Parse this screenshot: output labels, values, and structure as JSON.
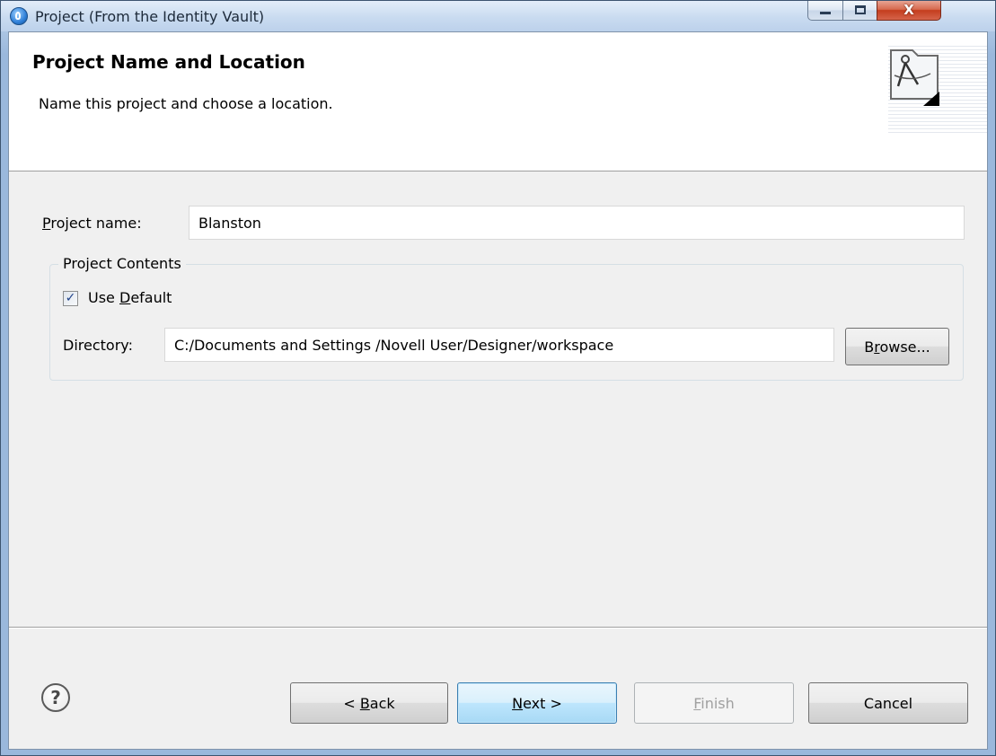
{
  "window": {
    "title": "Project (From the Identity Vault)",
    "close_glyph": "X"
  },
  "banner": {
    "title": "Project Name and Location",
    "description": "Name this project and choose a location."
  },
  "form": {
    "project_name_label": {
      "mnemonic": "P",
      "rest": "roject name:"
    },
    "project_name_value": "Blanston",
    "group_label": "Project Contents",
    "use_default": {
      "checked": true,
      "check_glyph": "✓",
      "label_pre": "Use ",
      "mnemonic": "D",
      "label_post": "efault"
    },
    "directory_label": "Directory:",
    "directory_value": "C:/Documents and Settings /Novell User/Designer/workspace",
    "browse": {
      "pre": "B",
      "mnemonic": "r",
      "post": "owse..."
    }
  },
  "footer": {
    "help_glyph": "?",
    "back": {
      "pre": "< ",
      "mnemonic": "B",
      "post": "ack"
    },
    "next": {
      "pre": "",
      "mnemonic": "N",
      "post": "ext >"
    },
    "finish": {
      "pre": "",
      "mnemonic": "F",
      "post": "inish",
      "enabled": false
    },
    "cancel": "Cancel"
  },
  "colors": {
    "window_frame": "#aec7e4",
    "dialog_bg": "#f0f0f0",
    "default_button_border": "#3c7fb1",
    "close_button": "#c43d1e"
  }
}
